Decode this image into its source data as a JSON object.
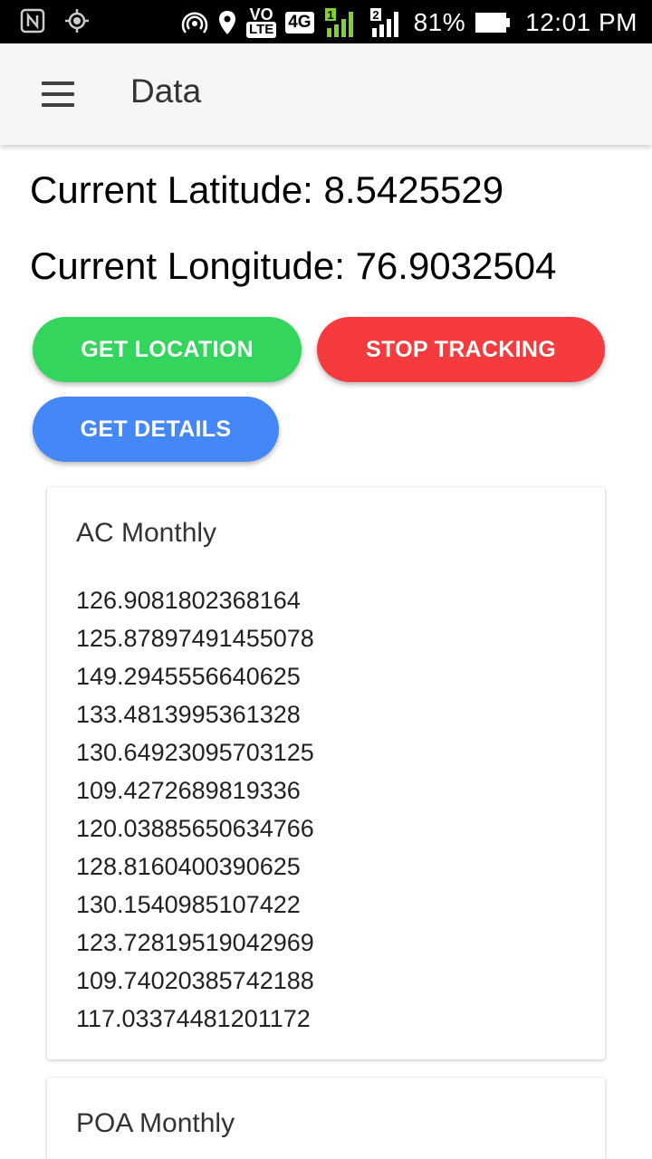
{
  "status_bar": {
    "battery": "81%",
    "time": "12:01 PM",
    "network": "4G",
    "volte_top": "VO",
    "volte_bottom": "LTE",
    "sim1": "1",
    "sim2": "2",
    "icons": [
      "nfc-icon",
      "gps-icon",
      "hotspot-icon",
      "location-icon",
      "volte-icon",
      "4g-icon",
      "signal-sim1-icon",
      "signal-sim2-icon",
      "battery-icon"
    ]
  },
  "app_bar": {
    "title": "Data",
    "menu_icon": "hamburger-menu-icon"
  },
  "location": {
    "latitude_text": "Current Latitude: 8.5425529",
    "longitude_text": "Current Longitude: 76.9032504"
  },
  "buttons": {
    "get_location": "GET LOCATION",
    "stop_tracking": "STOP TRACKING",
    "get_details": "GET DETAILS"
  },
  "colors": {
    "get_location": "#33d55c",
    "stop_tracking": "#f53b3e",
    "get_details": "#4487f7"
  },
  "ac_monthly": {
    "title": "AC Monthly",
    "values": [
      "126.9081802368164",
      "125.87897491455078",
      "149.2945556640625",
      "133.4813995361328",
      "130.64923095703125",
      "109.4272689819336",
      "120.03885650634766",
      "128.8160400390625",
      "130.1540985107422",
      "123.72819519042969",
      "109.74020385742188",
      "117.03374481201172"
    ]
  },
  "poa_monthly": {
    "title": "POA Monthly"
  }
}
